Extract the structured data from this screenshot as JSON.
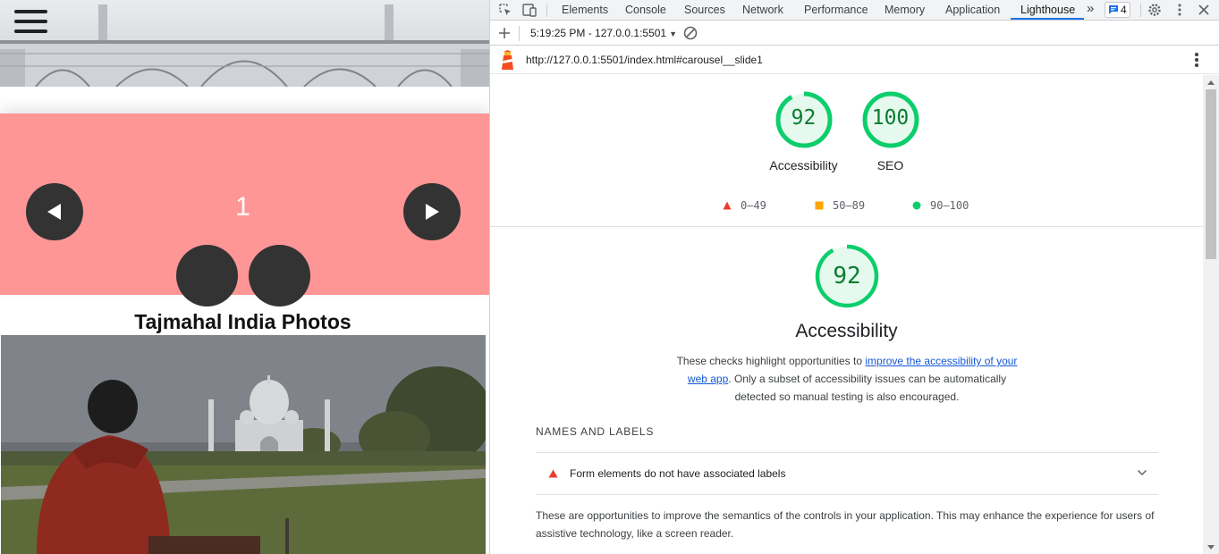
{
  "site": {
    "slide_number": "1",
    "photos_heading": "Tajmahal India Photos",
    "icons": {
      "menu": "hamburger-icon",
      "prev": "triangle-left-icon",
      "next": "triangle-right-icon"
    },
    "colors": {
      "carousel_bg": "#ff9696",
      "button_bg": "#333333"
    }
  },
  "devtools": {
    "tabs": [
      {
        "label": "Elements"
      },
      {
        "label": "Console"
      },
      {
        "label": "Sources"
      },
      {
        "label": "Network"
      },
      {
        "label": "Performance"
      },
      {
        "label": "Memory"
      },
      {
        "label": "Application"
      },
      {
        "label": "Lighthouse",
        "active": true
      }
    ],
    "more_tabs": "»",
    "issues_count": "4",
    "toolbar": {
      "report_selector": "5:19:25 PM - 127.0.0.1:5501"
    },
    "report_url": "http://127.0.0.1:5501/index.html#carousel__slide1",
    "summary_scores": [
      {
        "label": "Accessibility",
        "score": 92
      },
      {
        "label": "SEO",
        "score": 100
      }
    ],
    "legend": [
      {
        "range": "0–49",
        "shape": "triangle",
        "color": "#eb3b2e"
      },
      {
        "range": "50–89",
        "shape": "square",
        "color": "#ffa400"
      },
      {
        "range": "90–100",
        "shape": "circle",
        "color": "#0cce6b"
      }
    ],
    "category": {
      "score": 92,
      "title": "Accessibility",
      "desc_before": "These checks highlight opportunities to ",
      "desc_link": "improve the accessibility of your web app",
      "desc_after": ". Only a subset of accessibility issues can be automatically detected so manual testing is also encouraged."
    },
    "group": {
      "title": "NAMES AND LABELS",
      "audit_title": "Form elements do not have associated labels",
      "description": "These are opportunities to improve the semantics of the controls in your application. This may enhance the experience for users of assistive technology, like a screen reader."
    },
    "colors": {
      "pass": "#0cce6b",
      "pass_text": "#0a7c2f",
      "pass_fill": "#e6f9ee",
      "fail": "#eb3b2e",
      "accent": "#1a73e8"
    }
  }
}
